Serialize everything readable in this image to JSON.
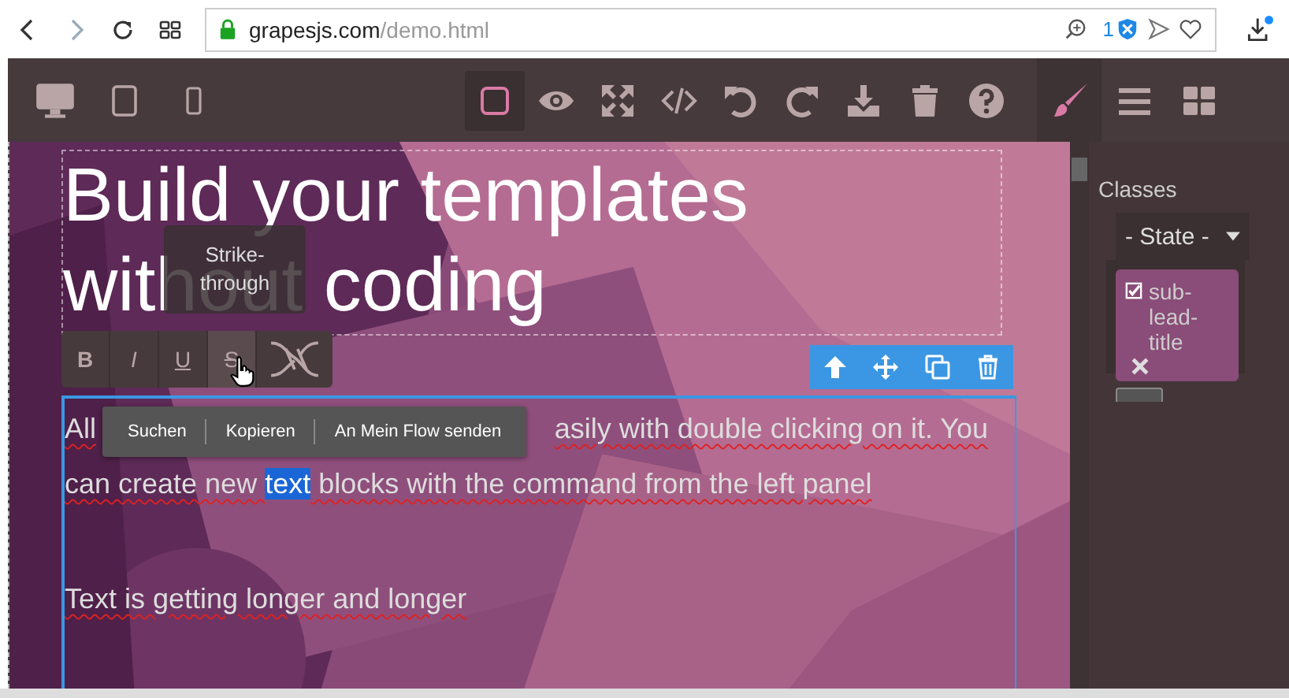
{
  "browser": {
    "url_host": "grapesjs.com",
    "url_path": "/demo.html",
    "badge_count": "1"
  },
  "devices": [
    {
      "kind": "desktop"
    },
    {
      "kind": "tablet"
    },
    {
      "kind": "mobile"
    }
  ],
  "toolbar": [
    {
      "kind": "border",
      "selected": true
    },
    {
      "kind": "preview",
      "selected": false
    },
    {
      "kind": "fullscreen",
      "selected": false
    },
    {
      "kind": "code",
      "selected": false
    },
    {
      "kind": "undo",
      "selected": false
    },
    {
      "kind": "redo",
      "selected": false
    },
    {
      "kind": "download",
      "selected": false
    },
    {
      "kind": "trash",
      "selected": false
    },
    {
      "kind": "help",
      "selected": false
    }
  ],
  "panel_tabs": [
    {
      "kind": "style",
      "selected": true
    },
    {
      "kind": "layers",
      "selected": false
    },
    {
      "kind": "blocks",
      "selected": false
    }
  ],
  "classes": {
    "label": "Classes",
    "state": "- State -",
    "tags": [
      {
        "name": "sub-lead-title",
        "checked": true
      }
    ]
  },
  "canvas": {
    "heading": "Build your templates without coding",
    "line_1": [
      "All",
      "asily with double clicking on it. You"
    ],
    "line_2": [
      {
        "text": "can create new ",
        "selected": false
      },
      {
        "text": "text",
        "selected": true
      },
      {
        "text": " blocks with the command from the left panel",
        "selected": false
      }
    ],
    "line_3": "Text is getting longer and longer"
  },
  "tooltip": "Strike-through",
  "rte_buttons": [
    {
      "kind": "bold",
      "label": "B",
      "hovered": false
    },
    {
      "kind": "italic",
      "label": "I",
      "hovered": false
    },
    {
      "kind": "underline",
      "label": "U",
      "hovered": false
    },
    {
      "kind": "strike",
      "label": "S",
      "hovered": true
    },
    {
      "kind": "link",
      "hovered": false
    }
  ],
  "component_toolbar": [
    {
      "kind": "up"
    },
    {
      "kind": "move"
    },
    {
      "kind": "copy"
    },
    {
      "kind": "delete"
    }
  ],
  "context_menu": [
    "Suchen",
    "Kopieren",
    "An Mein Flow senden"
  ]
}
